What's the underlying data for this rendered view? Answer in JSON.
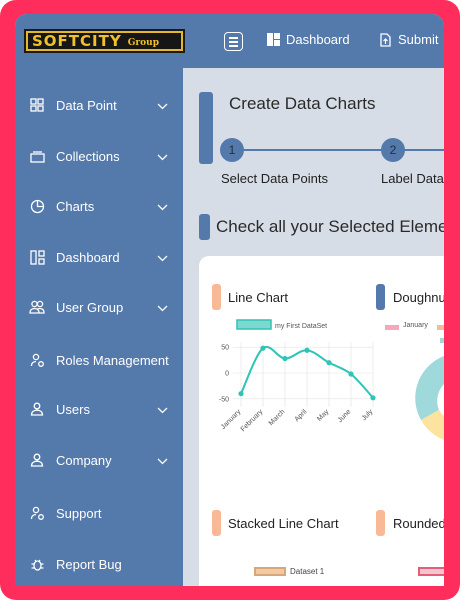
{
  "app": {
    "logo_main": "SOFTCITY",
    "logo_sub": "Group"
  },
  "topbar": {
    "menu_icon": "hamburger-icon",
    "links": [
      {
        "label": "Dashboard",
        "icon": "dashboard-icon"
      },
      {
        "label": "Submit",
        "icon": "upload-file-icon"
      }
    ]
  },
  "sidebar": {
    "items": [
      {
        "label": "Data Point",
        "icon": "grid-icon",
        "has_submenu": true
      },
      {
        "label": "Collections",
        "icon": "folder-stack-icon",
        "has_submenu": true
      },
      {
        "label": "Charts",
        "icon": "pie-chart-icon",
        "has_submenu": true
      },
      {
        "label": "Dashboard",
        "icon": "dashboard-icon",
        "has_submenu": true
      },
      {
        "label": "User Group",
        "icon": "user-group-icon",
        "has_submenu": true
      },
      {
        "label": "Roles Management",
        "icon": "user-gear-icon",
        "has_submenu": false
      },
      {
        "label": "Users",
        "icon": "user-icon",
        "has_submenu": true
      },
      {
        "label": "Company",
        "icon": "company-user-icon",
        "has_submenu": true
      },
      {
        "label": "Support",
        "icon": "support-user-icon",
        "has_submenu": false
      },
      {
        "label": "Report Bug",
        "icon": "bug-icon",
        "has_submenu": false
      }
    ]
  },
  "main": {
    "create_title": "Create Data Charts",
    "steps": [
      {
        "number": "1",
        "label": "Select Data Points"
      },
      {
        "number": "2",
        "label": "Label Data"
      }
    ],
    "check_title": "Check all your Selected Elements",
    "cards": [
      {
        "title": "Line Chart",
        "accent": "#f9b996"
      },
      {
        "title": "Doughnut Chart",
        "accent": "#5479ab"
      },
      {
        "title": "Stacked Line Chart",
        "accent": "#f9b996"
      },
      {
        "title": "Rounded Bar Chart",
        "accent": "#f9b996"
      }
    ],
    "doughnut_legend": [
      "January"
    ],
    "stacked_legend": [
      "Dataset 1"
    ]
  },
  "colors": {
    "sidebar_bg": "#5479ab",
    "frame": "#ff2d5b",
    "line_series": "#2ec4b6",
    "doughnut_teal": "#9fd9db",
    "doughnut_yellow": "#fce3a0",
    "legend_pink": "#f8a6bd"
  },
  "chart_data": {
    "type": "line",
    "categories": [
      "January",
      "February",
      "March",
      "April",
      "May",
      "June",
      "July"
    ],
    "series": [
      {
        "name": "my First DataSet",
        "values": [
          -40,
          48,
          28,
          44,
          20,
          -2,
          -48
        ],
        "color": "#2ec4b6"
      }
    ],
    "yticks": [
      50,
      0,
      -50
    ],
    "ylim": [
      -60,
      60
    ],
    "grid": true,
    "legend": "top"
  }
}
